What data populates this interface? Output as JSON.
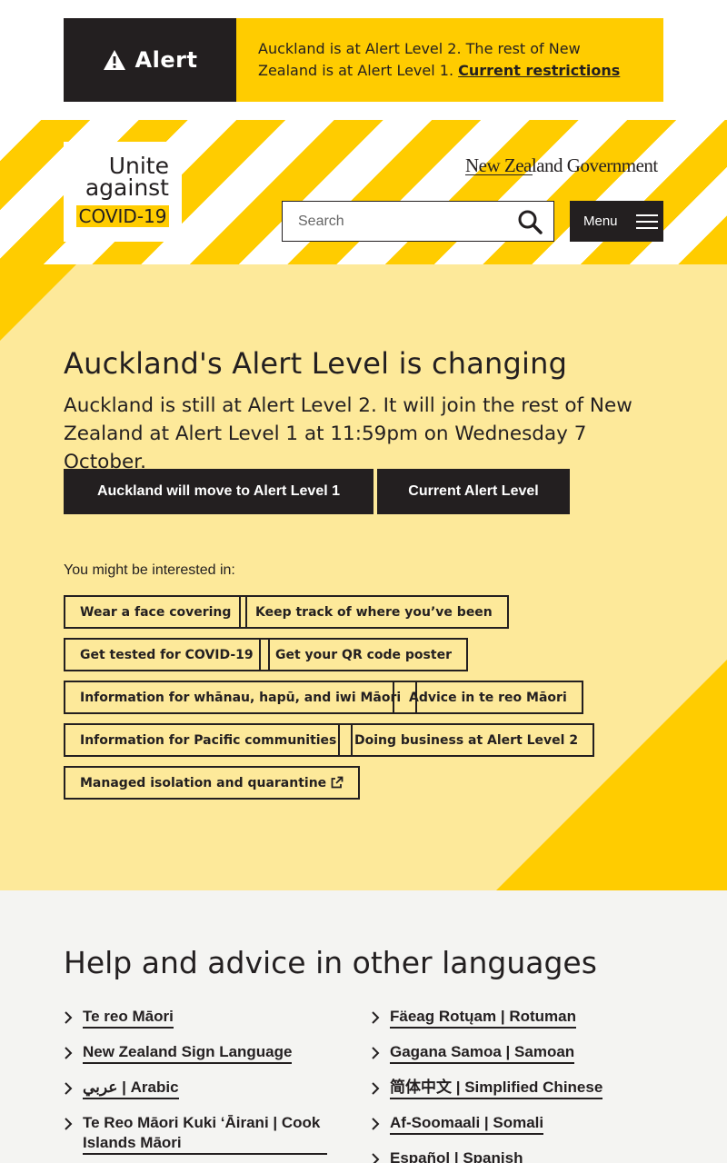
{
  "alert": {
    "label": "Alert",
    "message": "Auckland is at Alert Level 2. The rest of New Zealand is at Alert Level 1.",
    "link": "Current restrictions"
  },
  "header": {
    "logo": {
      "line1": "Unite",
      "line2": "against",
      "line3": "COVID-19"
    },
    "govt": "New Zealand Government",
    "search_placeholder": "Search",
    "menu_label": "Menu"
  },
  "hero": {
    "title": "Auckland's Alert Level is changing",
    "subtitle": "Auckland is still at Alert Level 2. It will join the rest of New Zealand at Alert Level 1 at 11:59pm on Wednesday 7 October.",
    "button_primary": "Auckland will move to Alert Level 1",
    "button_secondary": "Current Alert Level",
    "interest_label": "You might be interested in:",
    "links": [
      "Wear a face covering",
      "Keep track of where you’ve been",
      "Get tested for COVID-19",
      "Get your QR code poster",
      "Information for whānau, hapū, and iwi Māori",
      "Advice in te reo Māori",
      "Information for Pacific communities",
      "Doing business at Alert Level 2",
      "Managed isolation and quarantine"
    ]
  },
  "languages": {
    "title": "Help and advice in other languages",
    "left": [
      "Te reo Māori",
      "New Zealand Sign Language",
      "عربي | Arabic",
      "Te Reo Māori Kuki ‘Āirani | Cook Islands Māori"
    ],
    "right": [
      "Fäeag Rotųam | Rotuman",
      "Gagana Samoa | Samoan",
      "简体中文 | Simplified Chinese",
      "Af-Soomaali | Somali",
      "Español | Spanish"
    ]
  },
  "colors": {
    "brand_yellow": "#ffcc00",
    "hero_bg": "#fde99a",
    "dark": "#231f20",
    "lang_bg": "#f4f4f2"
  }
}
